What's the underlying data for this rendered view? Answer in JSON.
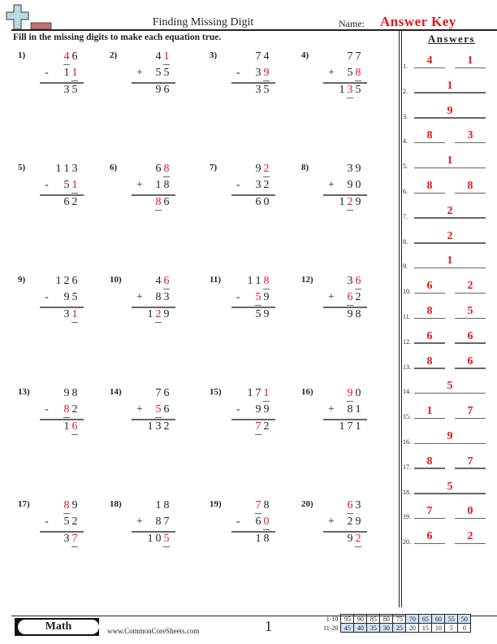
{
  "header": {
    "title": "Finding Missing Digit",
    "name_label": "Name:",
    "name_value": "Answer Key",
    "logo_icon": "plus-sign-icon"
  },
  "instructions": "Fill in the missing digits to make each equation true.",
  "answers_title": "Answers",
  "problems": [
    {
      "num": "1)",
      "top": [
        "4",
        "6"
      ],
      "op": "-",
      "bottom": [
        "1",
        "1"
      ],
      "result": [
        "3",
        "5"
      ],
      "missing": {
        "top": [
          0
        ],
        "bottom": [
          1
        ],
        "result": []
      }
    },
    {
      "num": "2)",
      "top": [
        "4",
        "1"
      ],
      "op": "+",
      "bottom": [
        "5",
        "5"
      ],
      "result": [
        "9",
        "6"
      ],
      "missing": {
        "top": [
          1
        ],
        "bottom": [],
        "result": []
      }
    },
    {
      "num": "3)",
      "top": [
        "7",
        "4"
      ],
      "op": "-",
      "bottom": [
        "3",
        "9"
      ],
      "result": [
        "3",
        "5"
      ],
      "missing": {
        "top": [],
        "bottom": [
          1
        ],
        "result": []
      }
    },
    {
      "num": "4)",
      "top": [
        "7",
        "7"
      ],
      "op": "+",
      "bottom": [
        "5",
        "8"
      ],
      "result": [
        "1",
        "3",
        "5"
      ],
      "missing": {
        "top": [],
        "bottom": [
          1
        ],
        "result": [
          1
        ]
      }
    },
    {
      "num": "5)",
      "top": [
        "1",
        "1",
        "3"
      ],
      "op": "-",
      "bottom": [
        "5",
        "1"
      ],
      "result": [
        "6",
        "2"
      ],
      "missing": {
        "top": [],
        "bottom": [
          1
        ],
        "result": []
      }
    },
    {
      "num": "6)",
      "top": [
        "6",
        "8"
      ],
      "op": "+",
      "bottom": [
        "1",
        "8"
      ],
      "result": [
        "8",
        "6"
      ],
      "missing": {
        "top": [
          1
        ],
        "bottom": [],
        "result": [
          0
        ]
      }
    },
    {
      "num": "7)",
      "top": [
        "9",
        "2"
      ],
      "op": "-",
      "bottom": [
        "3",
        "2"
      ],
      "result": [
        "6",
        "0"
      ],
      "missing": {
        "top": [
          1
        ],
        "bottom": [],
        "result": []
      }
    },
    {
      "num": "8)",
      "top": [
        "3",
        "9"
      ],
      "op": "+",
      "bottom": [
        "9",
        "0"
      ],
      "result": [
        "1",
        "2",
        "9"
      ],
      "missing": {
        "top": [],
        "bottom": [],
        "result": [
          1
        ]
      }
    },
    {
      "num": "9)",
      "top": [
        "1",
        "2",
        "6"
      ],
      "op": "-",
      "bottom": [
        "9",
        "5"
      ],
      "result": [
        "3",
        "1"
      ],
      "missing": {
        "top": [],
        "bottom": [],
        "result": [
          1
        ]
      }
    },
    {
      "num": "10)",
      "top": [
        "4",
        "6"
      ],
      "op": "+",
      "bottom": [
        "8",
        "3"
      ],
      "result": [
        "1",
        "2",
        "9"
      ],
      "missing": {
        "top": [
          1
        ],
        "bottom": [],
        "result": [
          1
        ]
      }
    },
    {
      "num": "11)",
      "top": [
        "1",
        "1",
        "8"
      ],
      "op": "-",
      "bottom": [
        "5",
        "9"
      ],
      "result": [
        "5",
        "9"
      ],
      "missing": {
        "top": [
          2
        ],
        "bottom": [
          0
        ],
        "result": []
      }
    },
    {
      "num": "12)",
      "top": [
        "3",
        "6"
      ],
      "op": "+",
      "bottom": [
        "6",
        "2"
      ],
      "result": [
        "9",
        "8"
      ],
      "missing": {
        "top": [
          1
        ],
        "bottom": [
          0
        ],
        "result": []
      }
    },
    {
      "num": "13)",
      "top": [
        "9",
        "8"
      ],
      "op": "-",
      "bottom": [
        "8",
        "2"
      ],
      "result": [
        "1",
        "6"
      ],
      "missing": {
        "top": [],
        "bottom": [
          0
        ],
        "result": [
          1
        ]
      }
    },
    {
      "num": "14)",
      "top": [
        "7",
        "6"
      ],
      "op": "+",
      "bottom": [
        "5",
        "6"
      ],
      "result": [
        "1",
        "3",
        "2"
      ],
      "missing": {
        "top": [],
        "bottom": [
          0
        ],
        "result": []
      }
    },
    {
      "num": "15)",
      "top": [
        "1",
        "7",
        "1"
      ],
      "op": "-",
      "bottom": [
        "9",
        "9"
      ],
      "result": [
        "7",
        "2"
      ],
      "missing": {
        "top": [
          2
        ],
        "bottom": [],
        "result": [
          0
        ]
      }
    },
    {
      "num": "16)",
      "top": [
        "9",
        "0"
      ],
      "op": "+",
      "bottom": [
        "8",
        "1"
      ],
      "result": [
        "1",
        "7",
        "1"
      ],
      "missing": {
        "top": [
          0
        ],
        "bottom": [],
        "result": []
      }
    },
    {
      "num": "17)",
      "top": [
        "8",
        "9"
      ],
      "op": "-",
      "bottom": [
        "5",
        "2"
      ],
      "result": [
        "3",
        "7"
      ],
      "missing": {
        "top": [
          0
        ],
        "bottom": [],
        "result": [
          1
        ]
      }
    },
    {
      "num": "18)",
      "top": [
        "1",
        "8"
      ],
      "op": "+",
      "bottom": [
        "8",
        "7"
      ],
      "result": [
        "1",
        "0",
        "5"
      ],
      "missing": {
        "top": [],
        "bottom": [],
        "result": [
          2
        ]
      }
    },
    {
      "num": "19)",
      "top": [
        "7",
        "8"
      ],
      "op": "-",
      "bottom": [
        "6",
        "0"
      ],
      "result": [
        "1",
        "8"
      ],
      "missing": {
        "top": [
          0
        ],
        "bottom": [
          1
        ],
        "result": []
      }
    },
    {
      "num": "20)",
      "top": [
        "6",
        "3"
      ],
      "op": "+",
      "bottom": [
        "2",
        "9"
      ],
      "result": [
        "9",
        "2"
      ],
      "missing": {
        "top": [
          0
        ],
        "bottom": [],
        "result": [
          1
        ]
      }
    }
  ],
  "answers": [
    {
      "label": "1.",
      "values": [
        "4",
        "1"
      ]
    },
    {
      "label": "2.",
      "values": [
        "1"
      ]
    },
    {
      "label": "3.",
      "values": [
        "9"
      ]
    },
    {
      "label": "4.",
      "values": [
        "8",
        "3"
      ]
    },
    {
      "label": "5.",
      "values": [
        "1"
      ]
    },
    {
      "label": "6.",
      "values": [
        "8",
        "8"
      ]
    },
    {
      "label": "7.",
      "values": [
        "2"
      ]
    },
    {
      "label": "8.",
      "values": [
        "2"
      ]
    },
    {
      "label": "9.",
      "values": [
        "1"
      ]
    },
    {
      "label": "10.",
      "values": [
        "6",
        "2"
      ]
    },
    {
      "label": "11.",
      "values": [
        "8",
        "5"
      ]
    },
    {
      "label": "12.",
      "values": [
        "6",
        "6"
      ]
    },
    {
      "label": "13.",
      "values": [
        "8",
        "6"
      ]
    },
    {
      "label": "14.",
      "values": [
        "5"
      ]
    },
    {
      "label": "15.",
      "values": [
        "1",
        "7"
      ]
    },
    {
      "label": "16.",
      "values": [
        "9"
      ]
    },
    {
      "label": "17.",
      "values": [
        "8",
        "7"
      ]
    },
    {
      "label": "18.",
      "values": [
        "5"
      ]
    },
    {
      "label": "19.",
      "values": [
        "7",
        "0"
      ]
    },
    {
      "label": "20.",
      "values": [
        "6",
        "2"
      ]
    }
  ],
  "footer": {
    "subject": "Math",
    "site": "www.CommonCoreSheets.com",
    "page": "1",
    "score_rows": [
      {
        "label": "1-10",
        "values": [
          "95",
          "90",
          "85",
          "80",
          "75",
          "70",
          "65",
          "60",
          "55",
          "50"
        ],
        "highlight": [
          5,
          6,
          7,
          8,
          9
        ]
      },
      {
        "label": "11-20",
        "values": [
          "45",
          "40",
          "35",
          "30",
          "25",
          "20",
          "15",
          "10",
          "5",
          "0"
        ],
        "highlight": [
          0,
          1,
          2,
          3,
          4
        ]
      }
    ]
  },
  "colors": {
    "answer_red": "#e0161b",
    "highlight_blue": "#cfe0f5"
  }
}
